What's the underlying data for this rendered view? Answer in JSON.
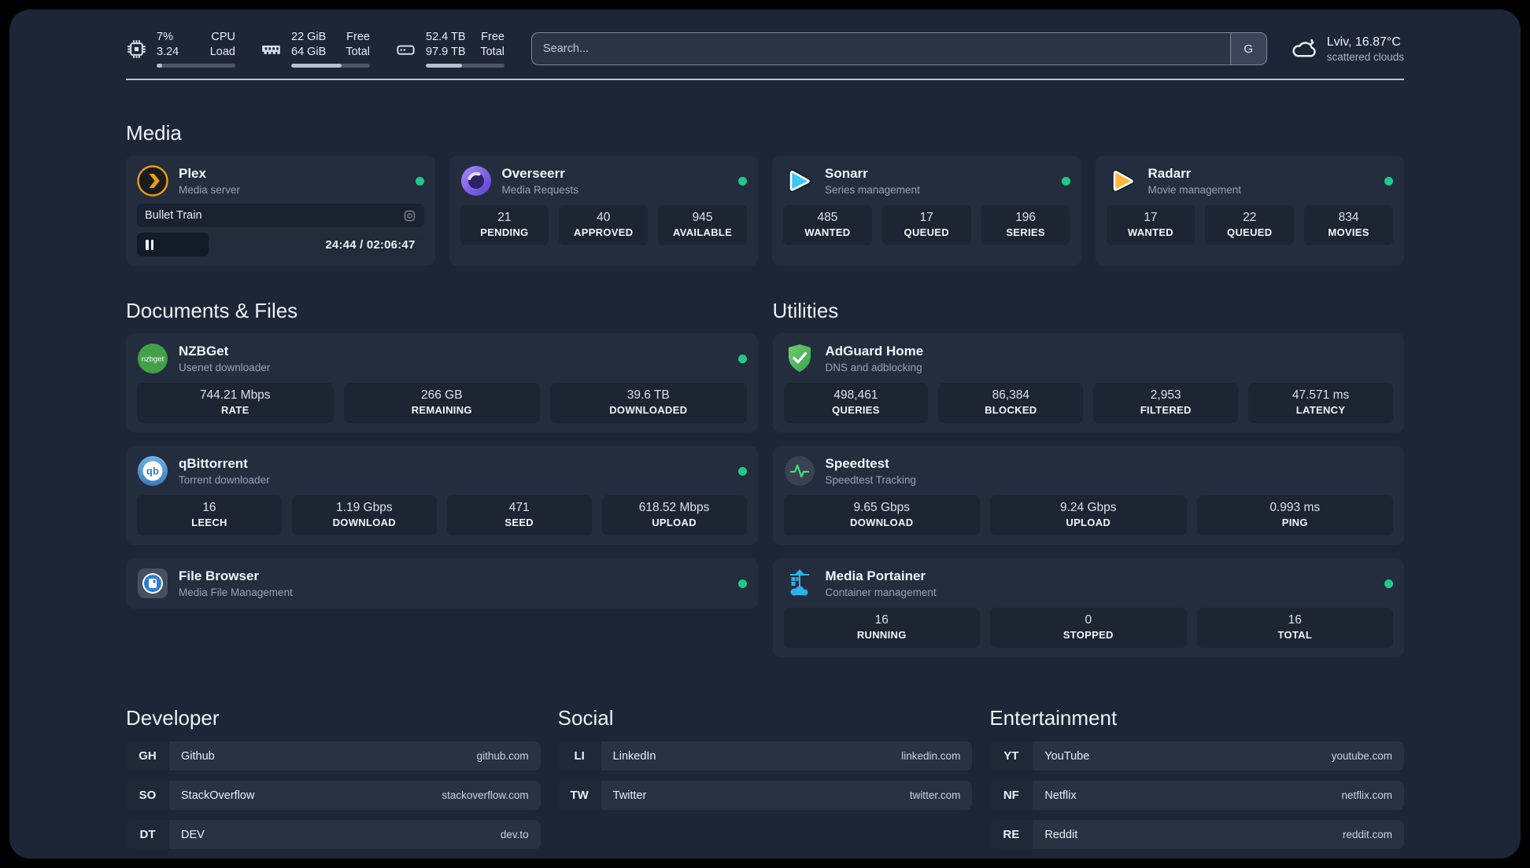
{
  "header": {
    "system_stats": [
      {
        "icon": "cpu-icon",
        "values": [
          "7%",
          "3.24"
        ],
        "labels": [
          "CPU",
          "Load"
        ],
        "progress_pct": 7
      },
      {
        "icon": "memory-icon",
        "values": [
          "22 GiB",
          "64 GiB"
        ],
        "labels": [
          "Free",
          "Total"
        ],
        "progress_pct": 64
      },
      {
        "icon": "disk-icon",
        "values": [
          "52.4 TB",
          "97.9 TB"
        ],
        "labels": [
          "Free",
          "Total"
        ],
        "progress_pct": 46
      }
    ],
    "search": {
      "placeholder": "Search...",
      "engine_button": "G"
    },
    "weather": {
      "icon": "cloud-icon",
      "location": "Lviv, 16.87°C",
      "condition": "scattered clouds"
    }
  },
  "media": {
    "title": "Media",
    "plex": {
      "icon": "plex-icon",
      "name": "Plex",
      "description": "Media server",
      "now_playing": "Bullet Train",
      "time_display": "24:44 / 02:06:47",
      "progress_pct": 22
    },
    "cards": [
      {
        "icon": "overseerr-icon",
        "name": "Overseerr",
        "description": "Media Requests",
        "stats": [
          {
            "value": "21",
            "label": "PENDING"
          },
          {
            "value": "40",
            "label": "APPROVED"
          },
          {
            "value": "945",
            "label": "AVAILABLE"
          }
        ]
      },
      {
        "icon": "sonarr-icon",
        "name": "Sonarr",
        "description": "Series management",
        "stats": [
          {
            "value": "485",
            "label": "WANTED"
          },
          {
            "value": "17",
            "label": "QUEUED"
          },
          {
            "value": "196",
            "label": "SERIES"
          }
        ]
      },
      {
        "icon": "radarr-icon",
        "name": "Radarr",
        "description": "Movie management",
        "stats": [
          {
            "value": "17",
            "label": "WANTED"
          },
          {
            "value": "22",
            "label": "QUEUED"
          },
          {
            "value": "834",
            "label": "MOVIES"
          }
        ]
      }
    ]
  },
  "documents": {
    "title": "Documents & Files",
    "cards": [
      {
        "icon": "nzbget-icon",
        "name": "NZBGet",
        "description": "Usenet downloader",
        "stats": [
          {
            "value": "744.21 Mbps",
            "label": "RATE"
          },
          {
            "value": "266 GB",
            "label": "REMAINING"
          },
          {
            "value": "39.6 TB",
            "label": "DOWNLOADED"
          }
        ]
      },
      {
        "icon": "qbittorrent-icon",
        "name": "qBittorrent",
        "description": "Torrent downloader",
        "stats": [
          {
            "value": "16",
            "label": "LEECH"
          },
          {
            "value": "1.19 Gbps",
            "label": "DOWNLOAD"
          },
          {
            "value": "471",
            "label": "SEED"
          },
          {
            "value": "618.52 Mbps",
            "label": "UPLOAD"
          }
        ]
      },
      {
        "icon": "filebrowser-icon",
        "name": "File Browser",
        "description": "Media File Management",
        "stats": []
      }
    ]
  },
  "utilities": {
    "title": "Utilities",
    "cards": [
      {
        "icon": "adguard-icon",
        "name": "AdGuard Home",
        "description": "DNS and adblocking",
        "stats": [
          {
            "value": "498,461",
            "label": "QUERIES"
          },
          {
            "value": "86,384",
            "label": "BLOCKED"
          },
          {
            "value": "2,953",
            "label": "FILTERED"
          },
          {
            "value": "47.571 ms",
            "label": "LATENCY"
          }
        ]
      },
      {
        "icon": "speedtest-icon",
        "name": "Speedtest",
        "description": "Speedtest Tracking",
        "stats": [
          {
            "value": "9.65 Gbps",
            "label": "DOWNLOAD"
          },
          {
            "value": "9.24 Gbps",
            "label": "UPLOAD"
          },
          {
            "value": "0.993 ms",
            "label": "PING"
          }
        ]
      },
      {
        "icon": "portainer-icon",
        "name": "Media Portainer",
        "description": "Container management",
        "stats": [
          {
            "value": "16",
            "label": "RUNNING"
          },
          {
            "value": "0",
            "label": "STOPPED"
          },
          {
            "value": "16",
            "label": "TOTAL"
          }
        ]
      }
    ]
  },
  "bookmarks": [
    {
      "title": "Developer",
      "links": [
        {
          "tag": "GH",
          "name": "Github",
          "url": "github.com"
        },
        {
          "tag": "SO",
          "name": "StackOverflow",
          "url": "stackoverflow.com"
        },
        {
          "tag": "DT",
          "name": "DEV",
          "url": "dev.to"
        }
      ]
    },
    {
      "title": "Social",
      "links": [
        {
          "tag": "LI",
          "name": "LinkedIn",
          "url": "linkedin.com"
        },
        {
          "tag": "TW",
          "name": "Twitter",
          "url": "twitter.com"
        }
      ]
    },
    {
      "title": "Entertainment",
      "links": [
        {
          "tag": "YT",
          "name": "YouTube",
          "url": "youtube.com"
        },
        {
          "tag": "NF",
          "name": "Netflix",
          "url": "netflix.com"
        },
        {
          "tag": "RE",
          "name": "Reddit",
          "url": "reddit.com"
        }
      ]
    }
  ],
  "colors": {
    "status_online": "#1ec98a",
    "background": "#1d2636",
    "card": "#242d3e"
  }
}
